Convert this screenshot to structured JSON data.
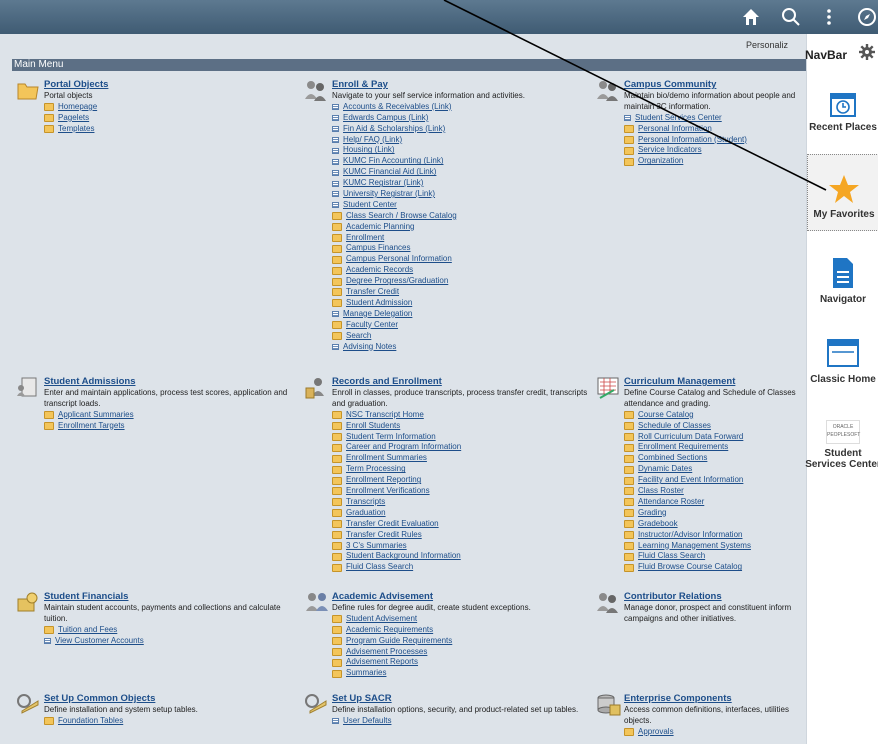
{
  "topbar": {
    "home_icon": "home-icon",
    "search_icon": "search-icon",
    "actions_icon": "more-vertical-icon",
    "navbar_icon": "compass-icon"
  },
  "personalize_label": "Personaliz",
  "menu_title": "Main Menu",
  "navbar": {
    "title": "NavBar",
    "items": [
      {
        "label": "Recent Places",
        "icon": "calendar-clock-icon"
      },
      {
        "label": "My Favorites",
        "icon": "star-icon"
      },
      {
        "label": "Navigator",
        "icon": "document-icon"
      },
      {
        "label": "Classic Home",
        "icon": "window-icon"
      },
      {
        "label": "Student Services Center",
        "icon": "oracle-peoplesoft-icon",
        "logo_text": [
          "ORACLE",
          "PEOPLESOFT"
        ]
      }
    ]
  },
  "sections": {
    "portal_objects": {
      "title": "Portal Objects",
      "desc": "Portal objects",
      "links": [
        {
          "label": "Homepage",
          "type": "folder"
        },
        {
          "label": "Pagelets",
          "type": "folder"
        },
        {
          "label": "Templates",
          "type": "folder"
        }
      ]
    },
    "enroll_pay": {
      "title": "Enroll & Pay",
      "desc": "Navigate to your self service information and activities.",
      "links": [
        {
          "label": "Accounts & Receivables (Link)",
          "type": "page"
        },
        {
          "label": "Edwards Campus (Link)",
          "type": "page"
        },
        {
          "label": "Fin Aid & Scholarships (Link)",
          "type": "page"
        },
        {
          "label": "Help/ FAQ (Link)",
          "type": "page"
        },
        {
          "label": "Housing (Link)",
          "type": "page"
        },
        {
          "label": "KUMC Fin Accounting (Link)",
          "type": "page"
        },
        {
          "label": "KUMC Financial Aid (Link)",
          "type": "page"
        },
        {
          "label": "KUMC Registrar (Link)",
          "type": "page"
        },
        {
          "label": "University Registrar (Link)",
          "type": "page"
        },
        {
          "label": "Student Center",
          "type": "page"
        },
        {
          "label": "Class Search / Browse Catalog",
          "type": "folder"
        },
        {
          "label": "Academic Planning",
          "type": "folder"
        },
        {
          "label": "Enrollment",
          "type": "folder"
        },
        {
          "label": "Campus Finances",
          "type": "folder"
        },
        {
          "label": "Campus Personal Information",
          "type": "folder"
        },
        {
          "label": "Academic Records",
          "type": "folder"
        },
        {
          "label": "Degree Progress/Graduation",
          "type": "folder"
        },
        {
          "label": "Transfer Credit",
          "type": "folder"
        },
        {
          "label": "Student Admission",
          "type": "folder"
        },
        {
          "label": "Manage Delegation",
          "type": "page"
        },
        {
          "label": "Faculty Center",
          "type": "folder"
        },
        {
          "label": "Search",
          "type": "folder"
        },
        {
          "label": "Advising Notes",
          "type": "page"
        }
      ]
    },
    "campus_community": {
      "title": "Campus Community",
      "desc": "Maintain bio/demo information about people and maintain 3C information.",
      "links": [
        {
          "label": "Student Services Center",
          "type": "page"
        },
        {
          "label": "Personal Information",
          "type": "folder"
        },
        {
          "label": "Personal Information (Student)",
          "type": "folder"
        },
        {
          "label": "Service Indicators",
          "type": "folder"
        },
        {
          "label": "Organization",
          "type": "folder"
        }
      ]
    },
    "student_admissions": {
      "title": "Student Admissions",
      "desc": "Enter and maintain applications, process test scores, application and transcript loads.",
      "links": [
        {
          "label": "Applicant Summaries",
          "type": "folder"
        },
        {
          "label": "Enrollment Targets",
          "type": "folder"
        }
      ]
    },
    "records_enrollment": {
      "title": "Records and Enrollment",
      "desc": "Enroll in classes, produce transcripts, process transfer credit, transcripts and graduation.",
      "links": [
        {
          "label": "NSC Transcript Home",
          "type": "folder"
        },
        {
          "label": "Enroll Students",
          "type": "folder"
        },
        {
          "label": "Student Term Information",
          "type": "folder"
        },
        {
          "label": "Career and Program Information",
          "type": "folder"
        },
        {
          "label": "Enrollment Summaries",
          "type": "folder"
        },
        {
          "label": "Term Processing",
          "type": "folder"
        },
        {
          "label": "Enrollment Reporting",
          "type": "folder"
        },
        {
          "label": "Enrollment Verifications",
          "type": "folder"
        },
        {
          "label": "Transcripts",
          "type": "folder"
        },
        {
          "label": "Graduation",
          "type": "folder"
        },
        {
          "label": "Transfer Credit Evaluation",
          "type": "folder"
        },
        {
          "label": "Transfer Credit Rules",
          "type": "folder"
        },
        {
          "label": "3 C's Summaries",
          "type": "folder"
        },
        {
          "label": "Student Background Information",
          "type": "folder"
        },
        {
          "label": "Fluid Class Search",
          "type": "folder"
        }
      ]
    },
    "curriculum_management": {
      "title": "Curriculum Management",
      "desc": "Define Course Catalog and Schedule of Classes attendance and grading.",
      "links": [
        {
          "label": "Course Catalog",
          "type": "folder"
        },
        {
          "label": "Schedule of Classes",
          "type": "folder"
        },
        {
          "label": "Roll Curriculum Data Forward",
          "type": "folder"
        },
        {
          "label": "Enrollment Requirements",
          "type": "folder"
        },
        {
          "label": "Combined Sections",
          "type": "folder"
        },
        {
          "label": "Dynamic Dates",
          "type": "folder"
        },
        {
          "label": "Facility and Event Information",
          "type": "folder"
        },
        {
          "label": "Class Roster",
          "type": "folder"
        },
        {
          "label": "Attendance Roster",
          "type": "folder"
        },
        {
          "label": "Grading",
          "type": "folder"
        },
        {
          "label": "Gradebook",
          "type": "folder"
        },
        {
          "label": "Instructor/Advisor Information",
          "type": "folder"
        },
        {
          "label": "Learning Management Systems",
          "type": "folder"
        },
        {
          "label": "Fluid Class Search",
          "type": "folder"
        },
        {
          "label": "Fluid Browse Course Catalog",
          "type": "folder"
        }
      ]
    },
    "student_financials": {
      "title": "Student Financials",
      "desc": "Maintain student accounts, payments and collections and calculate tuition.",
      "links": [
        {
          "label": "Tuition and Fees",
          "type": "folder"
        },
        {
          "label": "View Customer Accounts",
          "type": "page"
        }
      ]
    },
    "academic_advisement": {
      "title": "Academic Advisement",
      "desc": "Define rules for degree audit, create student exceptions.",
      "links": [
        {
          "label": "Student Advisement",
          "type": "folder"
        },
        {
          "label": "Academic Requirements",
          "type": "folder"
        },
        {
          "label": "Program Guide Requirements",
          "type": "folder"
        },
        {
          "label": "Advisement Processes",
          "type": "folder"
        },
        {
          "label": "Advisement Reports",
          "type": "folder"
        },
        {
          "label": "Summaries",
          "type": "folder"
        }
      ]
    },
    "contributor_relations": {
      "title": "Contributor Relations",
      "desc": "Manage donor, prospect and constituent inform campaigns and other initiatives.",
      "links": []
    },
    "set_up_common_objects": {
      "title": "Set Up Common Objects",
      "desc": "Define installation and system setup tables.",
      "links": [
        {
          "label": "Foundation Tables",
          "type": "folder"
        }
      ]
    },
    "set_up_sacr": {
      "title": "Set Up SACR",
      "desc": "Define installation options, security, and product-related set up tables.",
      "links": [
        {
          "label": "User Defaults",
          "type": "page"
        }
      ]
    },
    "enterprise_components": {
      "title": "Enterprise Components",
      "desc": "Access common definitions, interfaces, utilities objects.",
      "links": [
        {
          "label": "Approvals",
          "type": "folder"
        }
      ]
    }
  }
}
